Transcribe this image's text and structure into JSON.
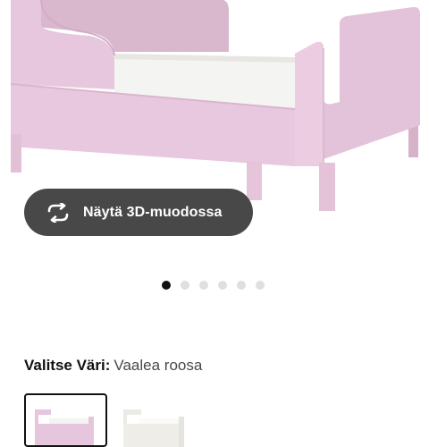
{
  "product_image": {
    "icon": "bed-image",
    "color": "#e6c6dc"
  },
  "view_3d_button": {
    "label": "Näytä 3D-muodossa",
    "icon": "rotate-3d-icon"
  },
  "carousel": {
    "dot_count": 6,
    "active_index": 0
  },
  "variant": {
    "heading_key": "Valitse Väri:",
    "heading_value": "Vaalea roosa",
    "swatches": [
      {
        "name": "Vaalea roosa",
        "color": "#e6c6dc",
        "selected": true
      },
      {
        "name": "",
        "color": "#f3f2ee",
        "selected": false
      }
    ]
  }
}
